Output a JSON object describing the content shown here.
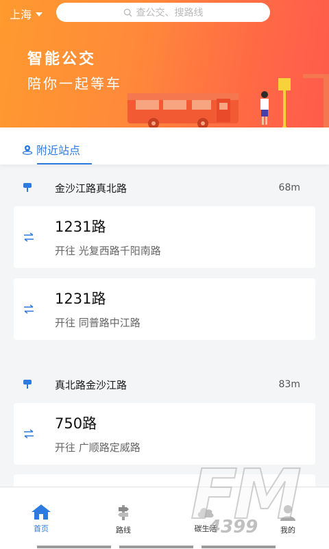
{
  "header": {
    "city": "上海",
    "search_placeholder": "查公交、搜路线",
    "slogan_line1": "智能公交",
    "slogan_line2": "陪你一起等车"
  },
  "tabs": [
    {
      "label": "附近站点",
      "active": true
    }
  ],
  "stations": [
    {
      "name": "金沙江路真北路",
      "distance": "68m",
      "routes": [
        {
          "route": "1231路",
          "direction": "开往 光复西路千阳南路"
        },
        {
          "route": "1231路",
          "direction": "开往 同普路中江路"
        }
      ]
    },
    {
      "name": "真北路金沙江路",
      "distance": "83m",
      "routes": [
        {
          "route": "750路",
          "direction": "开往 广顺路定威路"
        }
      ]
    }
  ],
  "bottom_nav": [
    {
      "label": "首页",
      "icon": "home-icon",
      "active": true
    },
    {
      "label": "路线",
      "icon": "route-sign-icon",
      "active": false
    },
    {
      "label": "碳生活",
      "icon": "cloud-icon",
      "active": false
    },
    {
      "label": "我的",
      "icon": "user-icon",
      "active": false
    }
  ],
  "watermark": {
    "text": "FM",
    "sub": "4399"
  },
  "colors": {
    "accent": "#2d7ae0",
    "banner_start": "#ff9a2e",
    "banner_end": "#ff5a4c",
    "background": "#f4f5f7"
  }
}
